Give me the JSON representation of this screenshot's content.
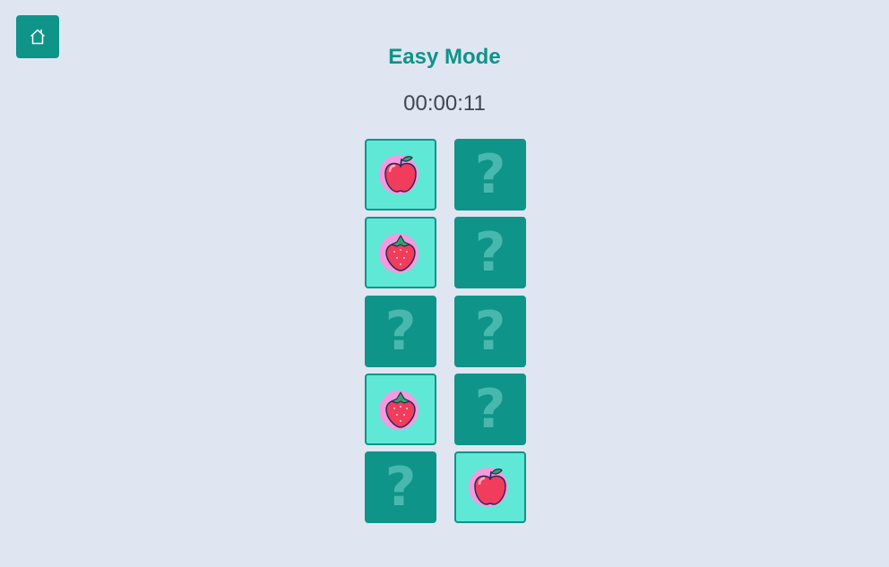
{
  "header": {
    "home_icon": "home-icon",
    "title": "Easy Mode",
    "timer": "00:00:11"
  },
  "colors": {
    "accent": "#0e9488",
    "background": "#dfe5f1",
    "revealed_card": "#5fe8d6",
    "hidden_card": "#0e9488",
    "question_mark": "#5cc4bb",
    "fruit_halo": "#f39be0"
  },
  "board": {
    "columns": 2,
    "hidden_symbol": "?",
    "cards": [
      {
        "state": "revealed",
        "fruit": "apple"
      },
      {
        "state": "hidden",
        "fruit": null
      },
      {
        "state": "revealed",
        "fruit": "strawberry"
      },
      {
        "state": "hidden",
        "fruit": null
      },
      {
        "state": "hidden",
        "fruit": null
      },
      {
        "state": "hidden",
        "fruit": null
      },
      {
        "state": "revealed",
        "fruit": "strawberry"
      },
      {
        "state": "hidden",
        "fruit": null
      },
      {
        "state": "hidden",
        "fruit": null
      },
      {
        "state": "revealed",
        "fruit": "apple"
      }
    ]
  }
}
